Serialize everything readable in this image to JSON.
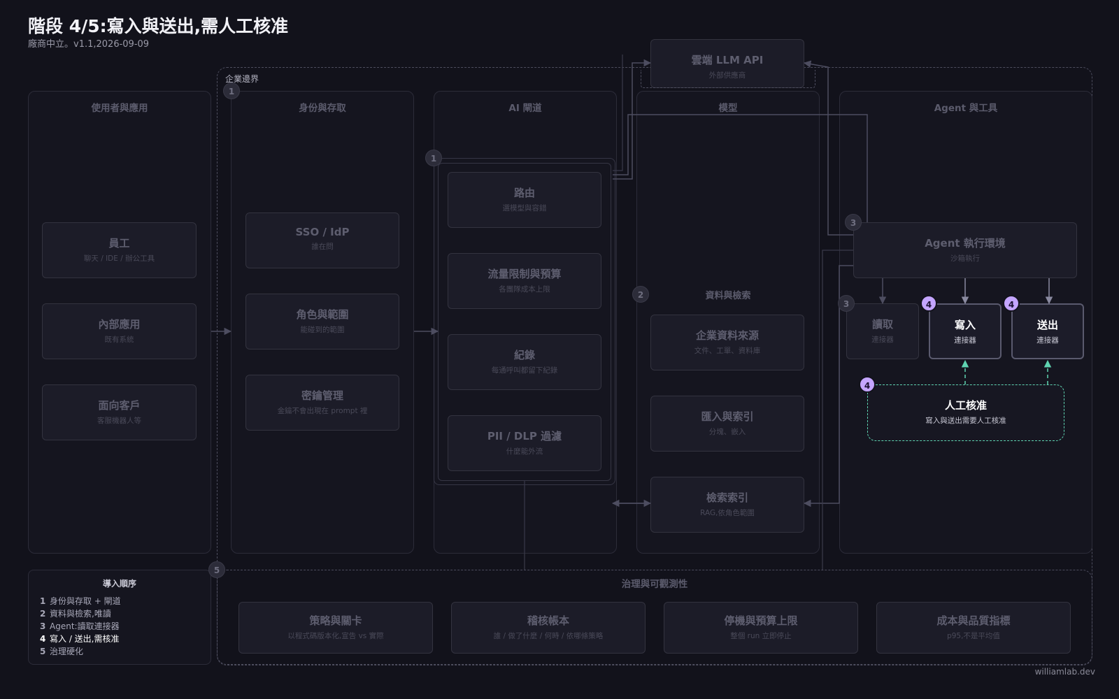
{
  "header": {
    "title": "階段 4/5:寫入與送出,需人工核准",
    "subtitle": "廠商中立。v1.1,2026-09-09"
  },
  "footer": "williamlab.dev",
  "enterprise_boundary": "企業邊界",
  "cloud": {
    "title": "雲端 LLM API",
    "subtitle": "外部供應商"
  },
  "lanes": {
    "users": {
      "title": "使用者與應用",
      "items": [
        {
          "title": "員工",
          "subtitle": "聊天 / IDE / 辦公工具"
        },
        {
          "title": "內部應用",
          "subtitle": "既有系統"
        },
        {
          "title": "面向客戶",
          "subtitle": "客服機器人等"
        }
      ]
    },
    "identity": {
      "title": "身份與存取",
      "items": [
        {
          "title": "SSO / IdP",
          "subtitle": "誰在問"
        },
        {
          "title": "角色與範圍",
          "subtitle": "能碰到的範圍"
        },
        {
          "title": "密鑰管理",
          "subtitle": "金鑰不會出現在 prompt 裡"
        }
      ]
    },
    "gateway": {
      "title": "AI 閘道",
      "items": [
        {
          "title": "路由",
          "subtitle": "選模型與容錯"
        },
        {
          "title": "流量限制與預算",
          "subtitle": "各團隊成本上限"
        },
        {
          "title": "紀錄",
          "subtitle": "每通呼叫都留下紀錄"
        },
        {
          "title": "PII / DLP 過濾",
          "subtitle": "什麼能外流"
        }
      ]
    },
    "models": {
      "title": "模型",
      "section": "資料與檢索",
      "items": [
        {
          "title": "企業資料來源",
          "subtitle": "文件、工單、資料庫"
        },
        {
          "title": "匯入與索引",
          "subtitle": "分塊、嵌入"
        },
        {
          "title": "檢索索引",
          "subtitle": "RAG,依角色範圍"
        }
      ]
    },
    "agent": {
      "title": "Agent 與工具",
      "runtime": {
        "title": "Agent 執行環境",
        "subtitle": "沙箱執行"
      },
      "read": {
        "title": "讀取",
        "subtitle": "連接器"
      },
      "write": {
        "title": "寫入",
        "subtitle": "連接器"
      },
      "send": {
        "title": "送出",
        "subtitle": "連接器"
      },
      "approval": {
        "title": "人工核准",
        "subtitle": "寫入與送出需要人工核准"
      }
    }
  },
  "badges": {
    "b1": "1",
    "b2": "2",
    "b3": "3",
    "b4": "4",
    "b5": "5"
  },
  "legend": {
    "title": "導入順序",
    "items": [
      {
        "n": "1",
        "label": "身份與存取 + 閘道"
      },
      {
        "n": "2",
        "label": "資料與檢索,唯讀"
      },
      {
        "n": "3",
        "label": "Agent:讀取連接器"
      },
      {
        "n": "4",
        "label": "寫入 / 送出,需核准"
      },
      {
        "n": "5",
        "label": "治理硬化"
      }
    ]
  },
  "governance": {
    "title": "治理與可觀測性",
    "items": [
      {
        "title": "策略與關卡",
        "subtitle": "以程式碼版本化,宣告 vs 實際"
      },
      {
        "title": "稽核帳本",
        "subtitle": "誰 / 做了什麼 / 何時 / 依哪條策略"
      },
      {
        "title": "停機與預算上限",
        "subtitle": "整個 run 立即停止"
      },
      {
        "title": "成本與品質指標",
        "subtitle": "p95,不是平均值"
      }
    ]
  },
  "colors": {
    "background": "#12121b",
    "active_badge": "#c4a5ff",
    "approval_border": "#5fd4b1",
    "inactive_text": "#5e5e6f"
  }
}
